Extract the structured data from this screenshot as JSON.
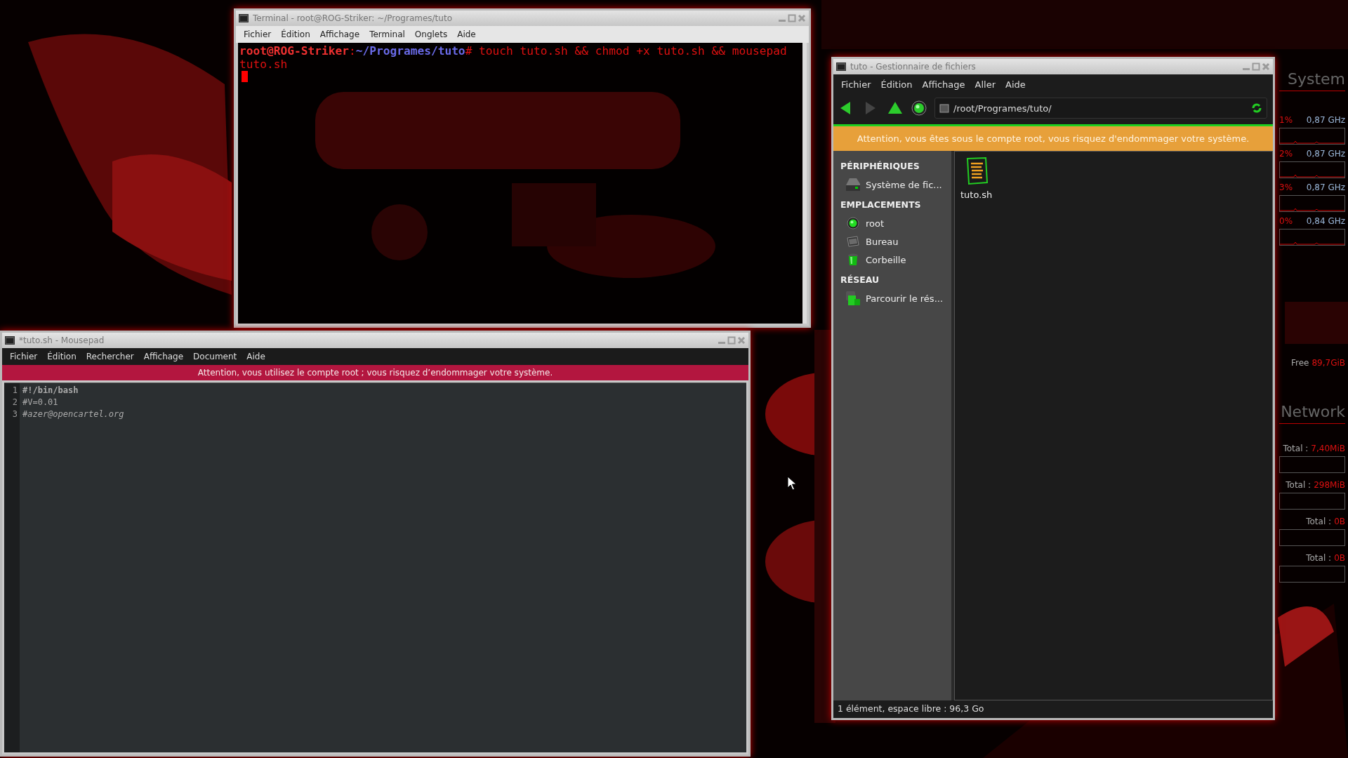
{
  "terminal": {
    "title": "Terminal - root@ROG-Striker: ~/Programes/tuto",
    "menu": [
      "Fichier",
      "Édition",
      "Affichage",
      "Terminal",
      "Onglets",
      "Aide"
    ],
    "prompt_user": "root@ROG-Striker",
    "prompt_separator": ":",
    "prompt_path": "~/Programes/tuto",
    "prompt_end": "#",
    "command": "touch tuto.sh && chmod +x tuto.sh && mousepad tuto.sh"
  },
  "mousepad": {
    "title": "*tuto.sh - Mousepad",
    "menu": [
      "Fichier",
      "Édition",
      "Rechercher",
      "Affichage",
      "Document",
      "Aide"
    ],
    "warning": "Attention, vous utilisez le compte root ; vous risquez d’endommager votre système.",
    "lines": [
      {
        "number": "1",
        "text": "#!/bin/bash",
        "kind": "bold"
      },
      {
        "number": "2",
        "text": "#V=0.01",
        "kind": "plain"
      },
      {
        "number": "3",
        "text": "#*azer@opencartel.org*",
        "kind": "plain"
      }
    ]
  },
  "file_manager": {
    "title": "tuto - Gestionnaire de fichiers",
    "menu": [
      "Fichier",
      "Édition",
      "Affichage",
      "Aller",
      "Aide"
    ],
    "toolbar": [
      {
        "kind": "back",
        "disabled": false
      },
      {
        "kind": "forward",
        "disabled": true
      },
      {
        "kind": "up",
        "disabled": false
      },
      {
        "kind": "home",
        "disabled": false
      }
    ],
    "address": "/root/Programes/tuto/",
    "warning": "Attention, vous êtes sous le compte root, vous risquez d'endommager votre système.",
    "sidebar": [
      {
        "heading": "PÉRIPHÉRIQUES",
        "items": [
          {
            "label": "Système de fic...",
            "kind": "drive"
          }
        ]
      },
      {
        "heading": "EMPLACEMENTS",
        "items": [
          {
            "label": "root",
            "kind": "home"
          },
          {
            "label": "Bureau",
            "kind": "desktop"
          },
          {
            "label": "Corbeille",
            "kind": "trash"
          }
        ]
      },
      {
        "heading": "RÉSEAU",
        "items": [
          {
            "label": "Parcourir le rés...",
            "kind": "network"
          }
        ]
      }
    ],
    "files": [
      {
        "name": "tuto.sh"
      }
    ],
    "status": "1 élément, espace libre : 96,3 Go"
  },
  "monitor": {
    "system_heading": "System",
    "cpu": [
      {
        "usage": "1%",
        "frequency": "0,87 GHz"
      },
      {
        "usage": "2%",
        "frequency": "0,87 GHz"
      },
      {
        "usage": "3%",
        "frequency": "0,87 GHz"
      },
      {
        "usage": "0%",
        "frequency": "0,84 GHz"
      }
    ],
    "disk": {
      "label": "Free",
      "value": "89,7GiB"
    },
    "network_heading": "Network",
    "transfers": [
      {
        "label": "Total :",
        "value": "7,40MiB"
      },
      {
        "label": "Total :",
        "value": "298MiB"
      },
      {
        "label": "Total :",
        "value": "0B"
      },
      {
        "label": "Total :",
        "value": "0B"
      }
    ]
  }
}
